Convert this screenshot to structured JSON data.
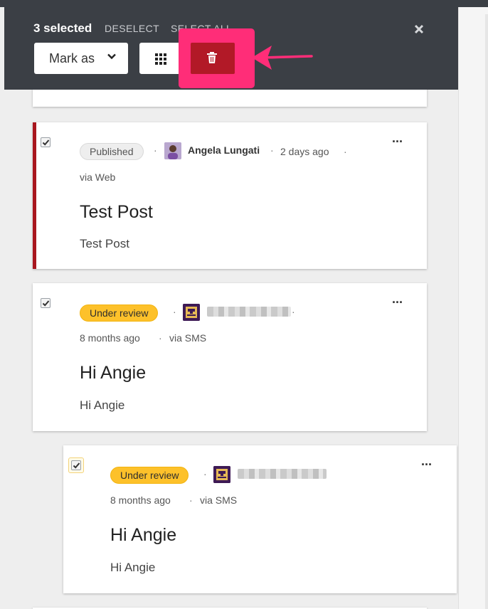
{
  "bulk_bar": {
    "count_label": "3 selected",
    "deselect_label": "DESELECT",
    "select_all_label": "SELECT ALL",
    "mark_as_label": "Mark as"
  },
  "colors": {
    "toolbar": "#3b3f45",
    "delete": "#b21927",
    "highlight": "#ff2d78",
    "under_review": "#fdc12a",
    "published_accent": "#a8161e"
  },
  "icons": {
    "close": "close-icon",
    "chevron": "chevron-down-icon",
    "grid": "grid-icon",
    "delete": "trash-icon",
    "more": "more-icon"
  },
  "posts": [
    {
      "status": "Published",
      "author": "Angela Lungati",
      "time": "2 days ago",
      "source": "via Web",
      "title": "Test Post",
      "body": "Test Post",
      "more": "···"
    },
    {
      "status": "Under review",
      "time": "8 months ago",
      "source": "via SMS",
      "title": "Hi Angie",
      "body": "Hi Angie",
      "more": "···"
    },
    {
      "status": "Under review",
      "time": "8 months ago",
      "source": "via SMS",
      "title": "Hi Angie",
      "body": "Hi Angie",
      "more": "···"
    }
  ],
  "separator": "·"
}
